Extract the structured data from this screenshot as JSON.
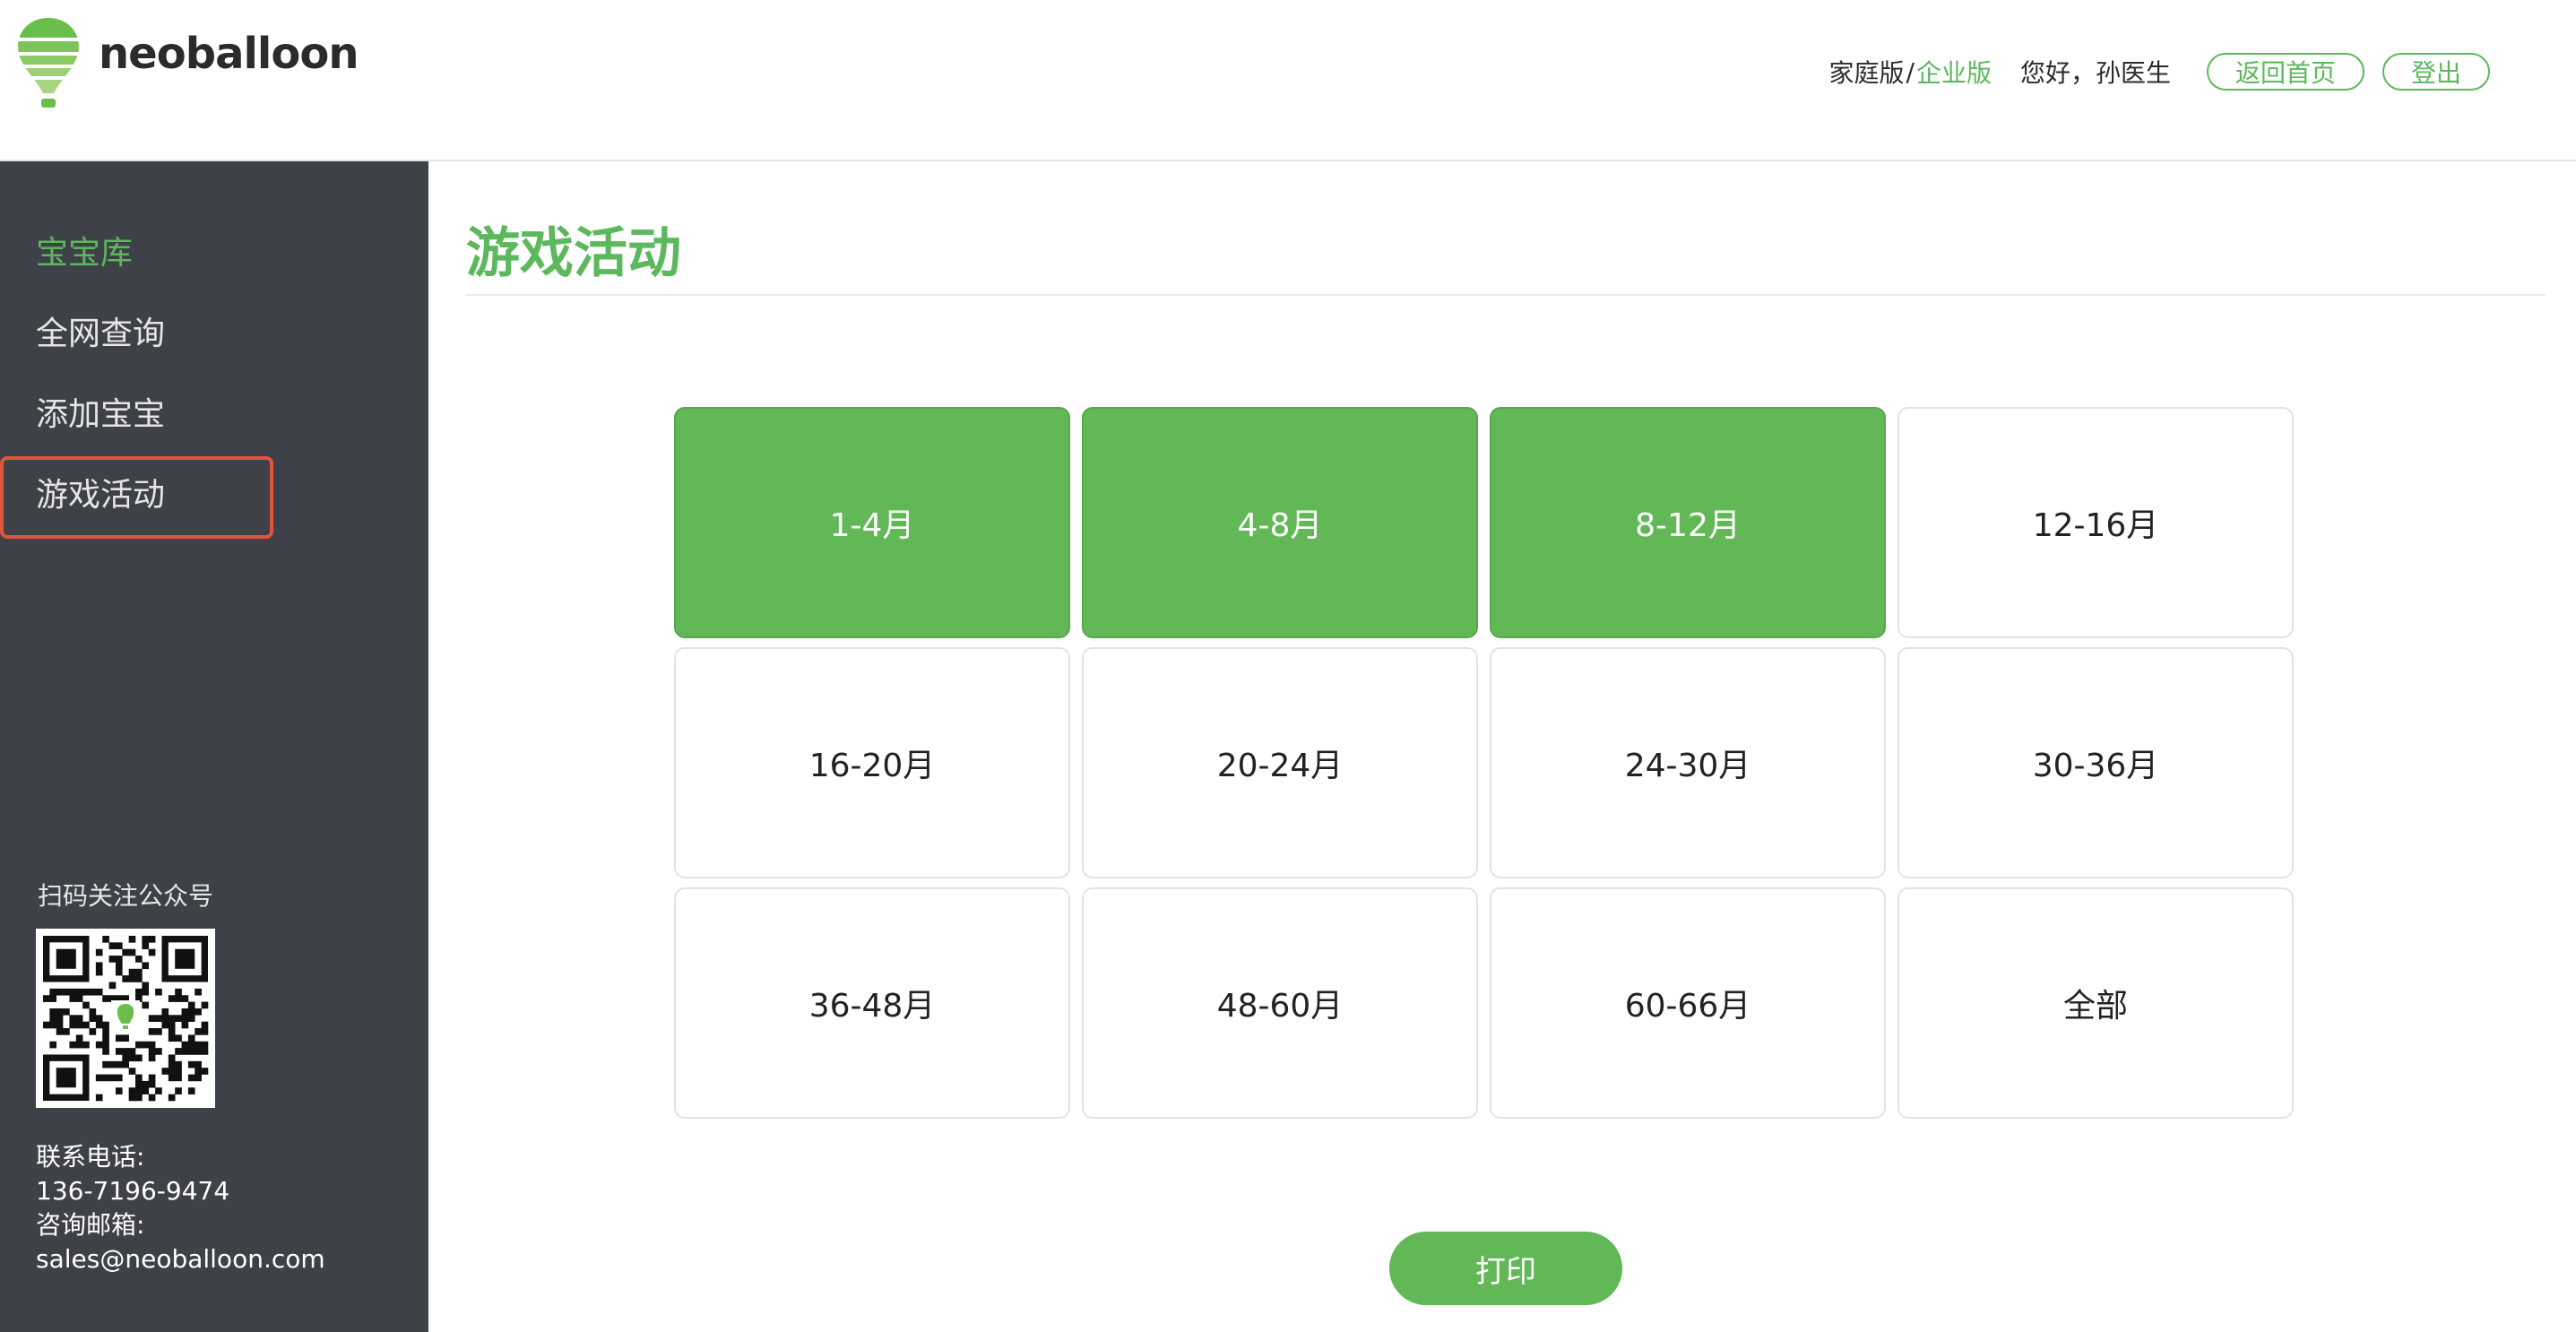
{
  "brand": {
    "name": "neoballoon",
    "accent_color": "#5cb85c",
    "logo_icon": "balloon-logo-icon"
  },
  "header": {
    "edition_home": "家庭版",
    "edition_sep": "/",
    "edition_enterprise": "企业版",
    "greeting": "您好，孙医生",
    "home_button": "返回首页",
    "logout_button": "登出"
  },
  "sidebar": {
    "items": [
      {
        "label": "宝宝库",
        "active": true
      },
      {
        "label": "全网查询"
      },
      {
        "label": "添加宝宝"
      },
      {
        "label": "游戏活动",
        "highlighted": true
      }
    ],
    "follow_label": "扫码关注公众号",
    "qr_icon": "qr-code-icon",
    "phone_label": "联系电话:",
    "phone": "136-7196-9474",
    "email_label": "咨询邮箱:",
    "email": "sales@neoballoon.com",
    "bg_color": "#3e4147"
  },
  "main": {
    "title": "游戏活动",
    "age_ranges": [
      {
        "label": "1-4月",
        "selected": true
      },
      {
        "label": "4-8月",
        "selected": true
      },
      {
        "label": "8-12月",
        "selected": true
      },
      {
        "label": "12-16月"
      },
      {
        "label": "16-20月"
      },
      {
        "label": "20-24月"
      },
      {
        "label": "24-30月"
      },
      {
        "label": "30-36月"
      },
      {
        "label": "36-48月"
      },
      {
        "label": "48-60月"
      },
      {
        "label": "60-66月"
      },
      {
        "label": "全部"
      }
    ],
    "print_button": "打印",
    "selected_color": "#62b856"
  }
}
